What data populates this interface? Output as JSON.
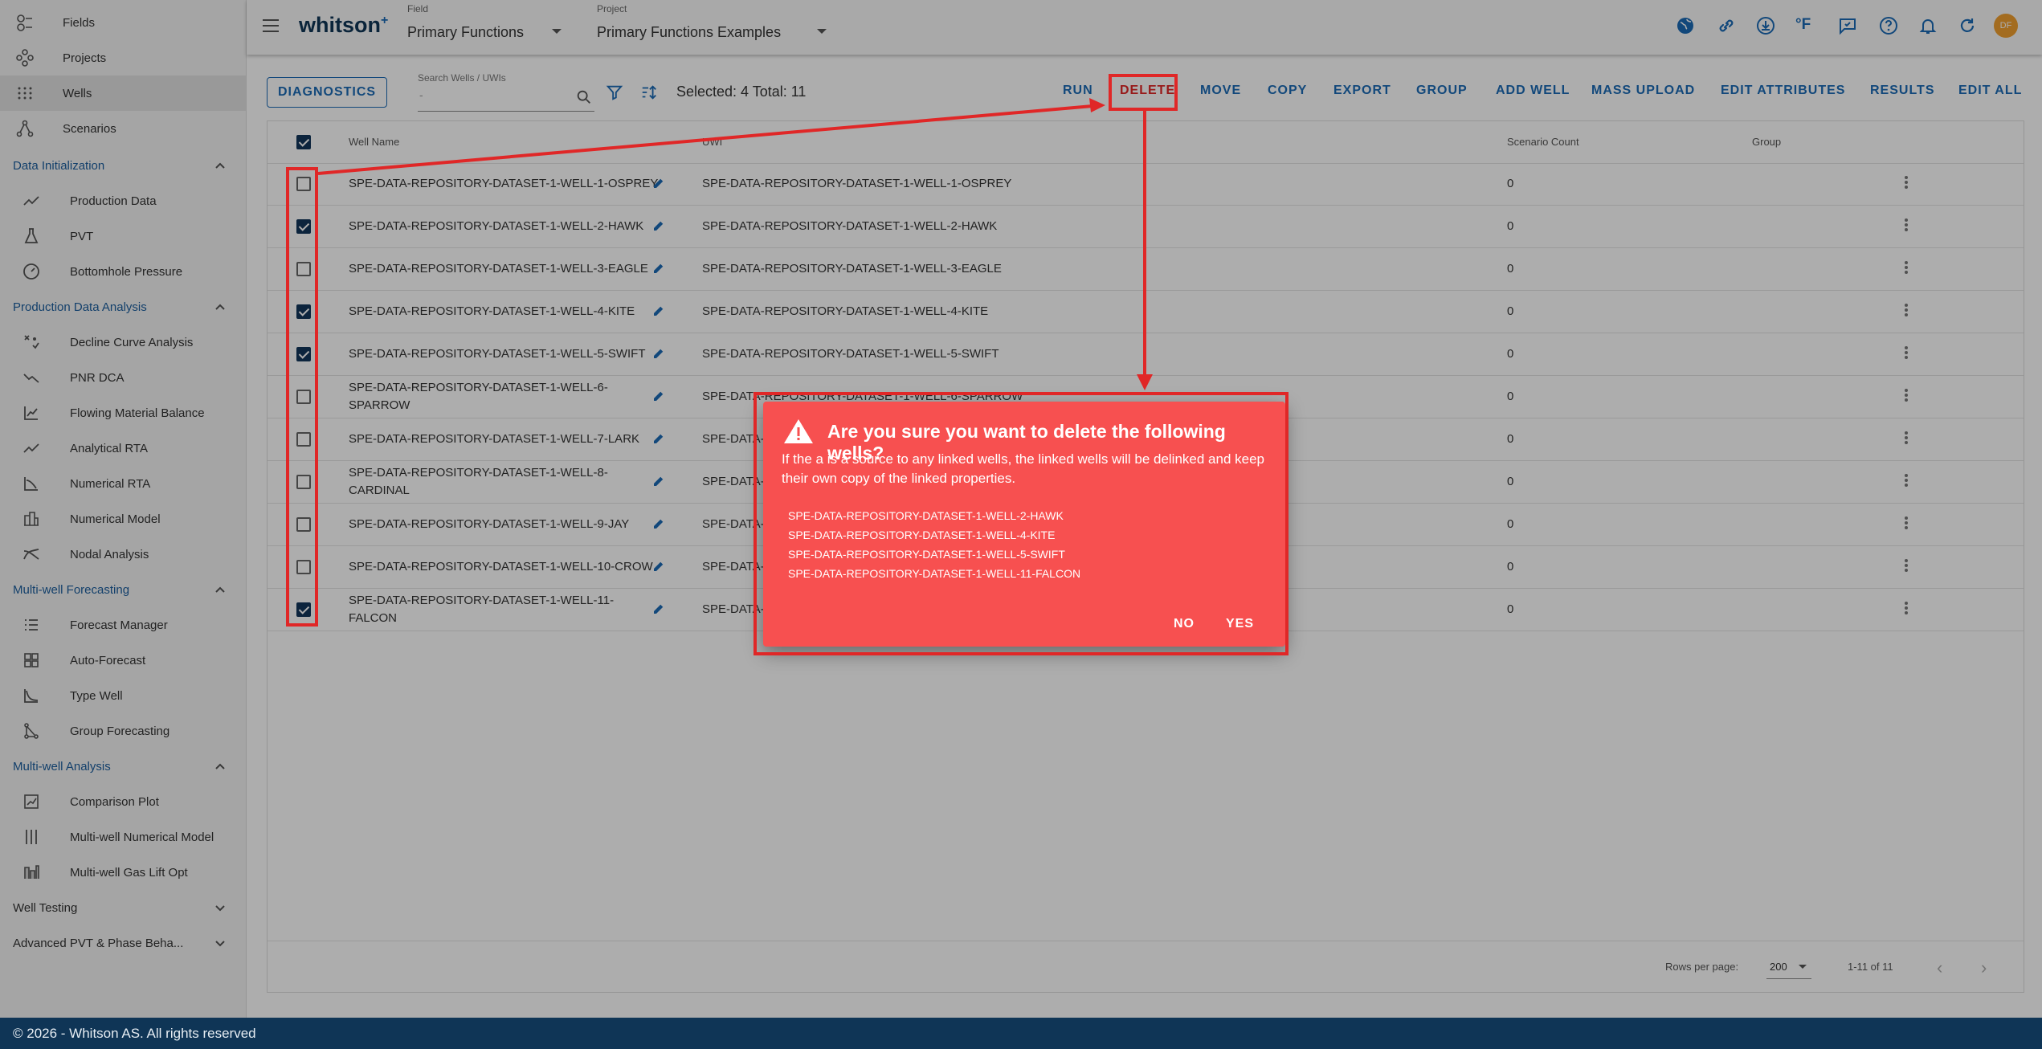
{
  "app": {
    "logo": "whitson",
    "logo_sup": "+"
  },
  "header": {
    "field_label": "Field",
    "field_value": "Primary Functions",
    "project_label": "Project",
    "project_value": "Primary Functions Examples",
    "temp_unit": "°F",
    "avatar_initials": "DF"
  },
  "sidebar": {
    "top_items": [
      {
        "label": "Fields",
        "icon": "fields-icon"
      },
      {
        "label": "Projects",
        "icon": "projects-icon"
      },
      {
        "label": "Wells",
        "icon": "wells-icon",
        "active": true
      },
      {
        "label": "Scenarios",
        "icon": "scenarios-icon"
      }
    ],
    "sections": [
      {
        "title": "Data Initialization",
        "expanded": true,
        "items": [
          "Production Data",
          "PVT",
          "Bottomhole Pressure"
        ]
      },
      {
        "title": "Production Data Analysis",
        "expanded": true,
        "items": [
          "Decline Curve Analysis",
          "PNR DCA",
          "Flowing Material Balance",
          "Analytical RTA",
          "Numerical RTA",
          "Numerical Model",
          "Nodal Analysis"
        ]
      },
      {
        "title": "Multi-well Forecasting",
        "expanded": true,
        "items": [
          "Forecast Manager",
          "Auto-Forecast",
          "Type Well",
          "Group Forecasting"
        ]
      },
      {
        "title": "Multi-well Analysis",
        "expanded": true,
        "items": [
          "Comparison Plot",
          "Multi-well Numerical Model",
          "Multi-well Gas Lift Opt"
        ]
      },
      {
        "title": "Well Testing",
        "expanded": false,
        "items": []
      },
      {
        "title": "Advanced PVT & Phase Beha...",
        "expanded": false,
        "items": []
      }
    ]
  },
  "toolbar": {
    "diagnostics": "DIAGNOSTICS",
    "search_label": "Search Wells / UWIs",
    "search_value": "-",
    "selection_text": "Selected: 4 Total: 11",
    "actions": [
      "RUN",
      "DELETE",
      "MOVE",
      "COPY",
      "EXPORT",
      "GROUP",
      "ADD WELL",
      "MASS UPLOAD",
      "EDIT ATTRIBUTES",
      "RESULTS",
      "EDIT ALL"
    ]
  },
  "table": {
    "columns": [
      "Well Name",
      "UWI",
      "Scenario Count",
      "Group"
    ],
    "rows": [
      {
        "name": [
          "SPE-DATA-REPOSITORY-DATASET-1-WELL-1-OSPREY"
        ],
        "uwi": "SPE-DATA-REPOSITORY-DATASET-1-WELL-1-OSPREY",
        "count": "0",
        "checked": false
      },
      {
        "name": [
          "SPE-DATA-REPOSITORY-DATASET-1-WELL-2-HAWK"
        ],
        "uwi": "SPE-DATA-REPOSITORY-DATASET-1-WELL-2-HAWK",
        "count": "0",
        "checked": true
      },
      {
        "name": [
          "SPE-DATA-REPOSITORY-DATASET-1-WELL-3-EAGLE"
        ],
        "uwi": "SPE-DATA-REPOSITORY-DATASET-1-WELL-3-EAGLE",
        "count": "0",
        "checked": false
      },
      {
        "name": [
          "SPE-DATA-REPOSITORY-DATASET-1-WELL-4-KITE"
        ],
        "uwi": "SPE-DATA-REPOSITORY-DATASET-1-WELL-4-KITE",
        "count": "0",
        "checked": true
      },
      {
        "name": [
          "SPE-DATA-REPOSITORY-DATASET-1-WELL-5-SWIFT"
        ],
        "uwi": "SPE-DATA-REPOSITORY-DATASET-1-WELL-5-SWIFT",
        "count": "0",
        "checked": true
      },
      {
        "name": [
          "SPE-DATA-REPOSITORY-DATASET-1-WELL-6-",
          "SPARROW"
        ],
        "uwi": "SPE-DATA-REPOSITORY-DATASET-1-WELL-6-SPARROW",
        "count": "0",
        "checked": false
      },
      {
        "name": [
          "SPE-DATA-REPOSITORY-DATASET-1-WELL-7-LARK"
        ],
        "uwi": "SPE-DATA-",
        "count": "0",
        "checked": false
      },
      {
        "name": [
          "SPE-DATA-REPOSITORY-DATASET-1-WELL-8-",
          "CARDINAL"
        ],
        "uwi": "SPE-DATA-",
        "count": "0",
        "checked": false
      },
      {
        "name": [
          "SPE-DATA-REPOSITORY-DATASET-1-WELL-9-JAY"
        ],
        "uwi": "SPE-DATA-",
        "count": "0",
        "checked": false
      },
      {
        "name": [
          "SPE-DATA-REPOSITORY-DATASET-1-WELL-10-CROW"
        ],
        "uwi": "SPE-DATA-",
        "count": "0",
        "checked": false
      },
      {
        "name": [
          "SPE-DATA-REPOSITORY-DATASET-1-WELL-11-",
          "FALCON"
        ],
        "uwi": "SPE-DATA-",
        "count": "0",
        "checked": true
      }
    ]
  },
  "pagination": {
    "rows_per_page_label": "Rows per page:",
    "rows_per_page": "200",
    "range": "1-11 of 11"
  },
  "dialog": {
    "title": "Are you sure you want to delete the following wells?",
    "message": "If the a is a source to any linked wells, the linked wells will be delinked and keep their own copy of the linked properties.",
    "wells": [
      "SPE-DATA-REPOSITORY-DATASET-1-WELL-2-HAWK",
      "SPE-DATA-REPOSITORY-DATASET-1-WELL-4-KITE",
      "SPE-DATA-REPOSITORY-DATASET-1-WELL-5-SWIFT",
      "SPE-DATA-REPOSITORY-DATASET-1-WELL-11-FALCON"
    ],
    "no_label": "NO",
    "yes_label": "YES"
  },
  "footer": {
    "text": "© 2026 - Whitson AS. All rights reserved"
  },
  "colors": {
    "accent": "#1b6bb5",
    "dialog_bg": "#f75050",
    "annotation": "#e02727",
    "footer_bg": "#0f3556",
    "checkbox": "#13355a"
  }
}
